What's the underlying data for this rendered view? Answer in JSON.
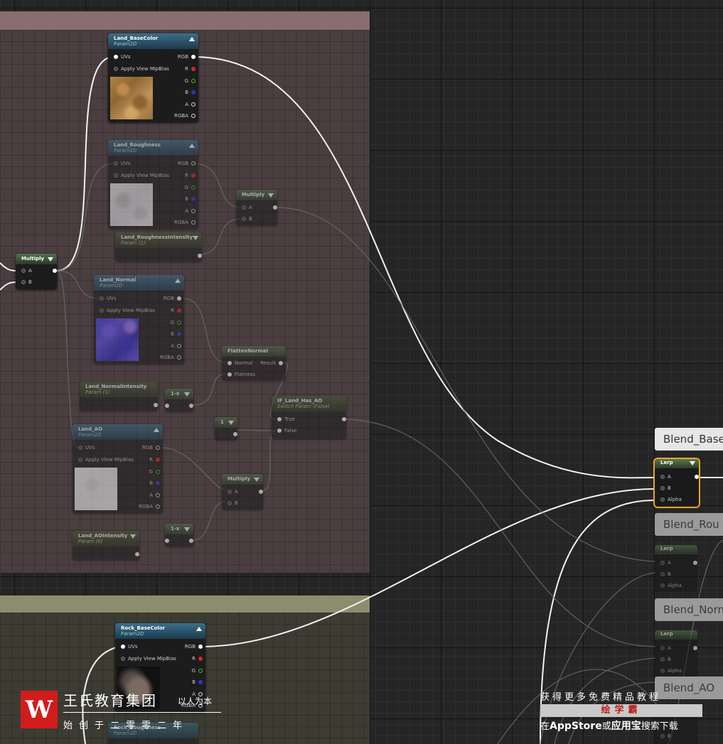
{
  "nodes": {
    "land_basecolor": {
      "title": "Land_BaseColor",
      "subtitle": "Param2D"
    },
    "land_roughness": {
      "title": "Land_Roughness",
      "subtitle": "Param2D"
    },
    "land_normal": {
      "title": "Land_Normal",
      "subtitle": "Param2D"
    },
    "land_ao": {
      "title": "Land_AO",
      "subtitle": "Param2D"
    },
    "rock_basecolor": {
      "title": "Rock_BaseColor",
      "subtitle": "Param2D"
    },
    "rock_roughness": {
      "title": "Rock_Roughness",
      "subtitle": "Param2D"
    },
    "multiply": {
      "title": "Multiply"
    },
    "roughness_intensity": {
      "title": "Land_RoughnessIntensity",
      "subtitle": "Param (1)"
    },
    "normal_intensity": {
      "title": "Land_NormalIntensity",
      "subtitle": "Param (1)"
    },
    "ao_intensity": {
      "title": "Land_AOIntensity",
      "subtitle": "Param (0)"
    },
    "flatten_normal": {
      "title": "FlattenNormal"
    },
    "one_minus": {
      "title": "1-x"
    },
    "constant_one": {
      "title": "1"
    },
    "has_ao_switch": {
      "title": "IF_Land_Has_AO",
      "subtitle": "Switch Param (False)"
    },
    "lerp": {
      "title": "Lerp"
    }
  },
  "pins": {
    "uvs": "UVs",
    "apply_view_mip_bias": "Apply View MipBias",
    "rgb": "RGB",
    "r": "R",
    "g": "G",
    "b": "B",
    "a": "A",
    "rgba": "RGBA",
    "A": "A",
    "B": "B",
    "alpha": "Alpha",
    "normal": "Normal",
    "flatness": "Flatness",
    "result": "Result",
    "true": "True",
    "false": "False"
  },
  "blend_labels": {
    "base": "Blend_Base",
    "rough": "Blend_Rou",
    "norm": "Blend_Norn",
    "ao": "Blend_AO"
  },
  "watermark": {
    "logo_letter": "W",
    "brand": "王氏教育集团",
    "motto": "以人为本",
    "founded": "始创于二零零二年",
    "promo_line1": "获得更多免费精品教程",
    "promo_box": "绘学霸",
    "promo_line2_prefix": "在",
    "promo_appstore": "AppStore",
    "promo_or": "或",
    "promo_yyb": "应用宝",
    "promo_line2_suffix": "搜索下载"
  },
  "colors": {
    "comment_land": "#8a6d6f",
    "comment_rock": "#8e8c6e",
    "selection": "#e8a52a",
    "logo_red": "#d21c1c"
  }
}
